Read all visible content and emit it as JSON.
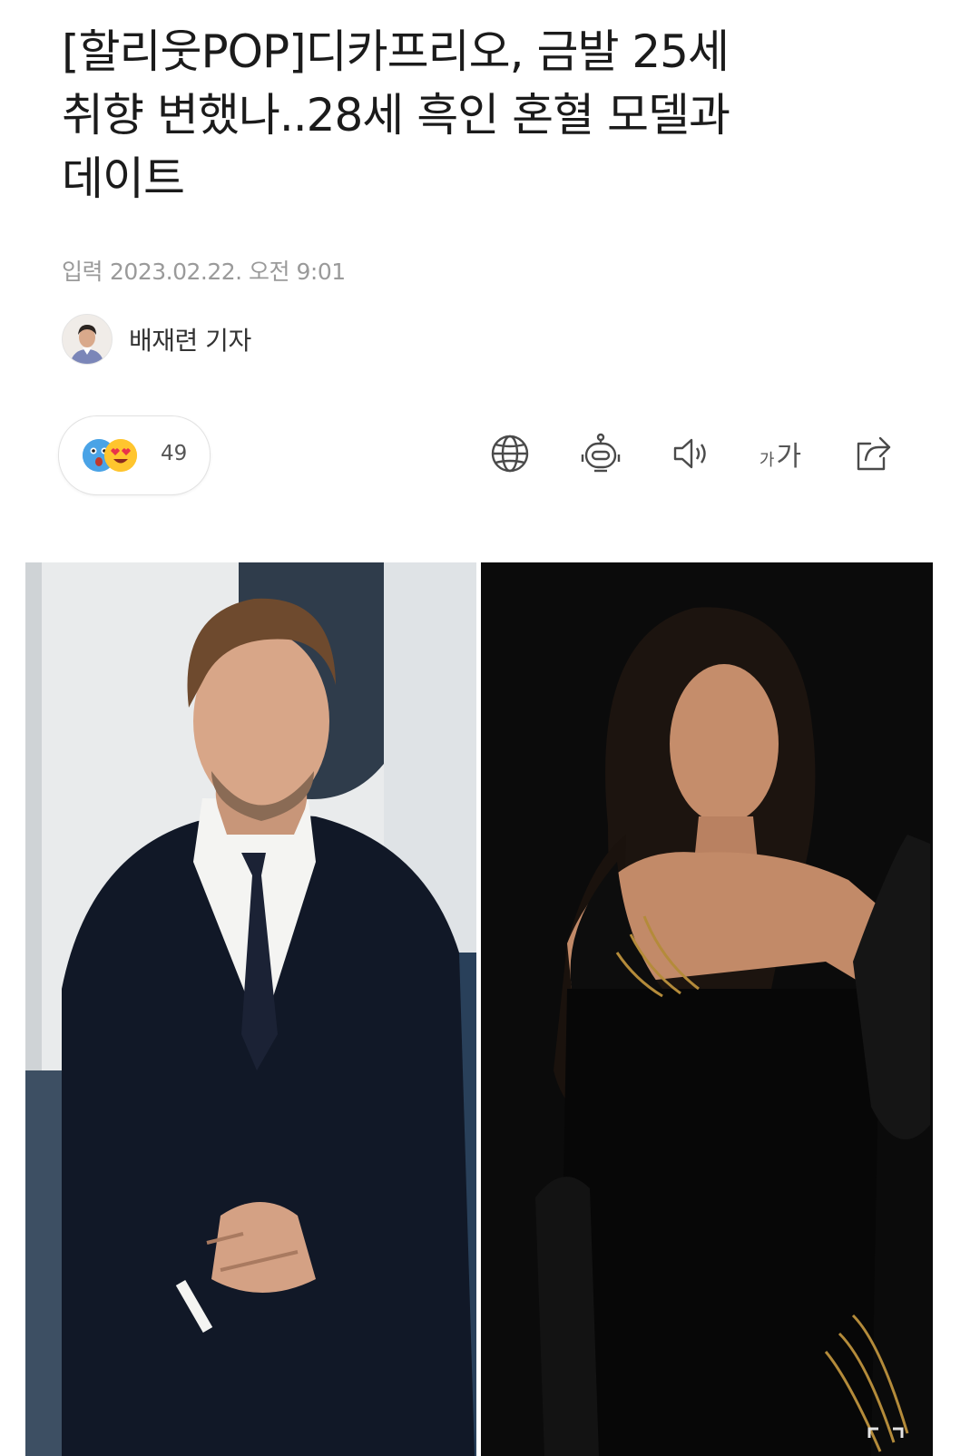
{
  "article": {
    "headline_line1": "[할리웃POP]디카프리오, 금발 25세",
    "headline_line2": "취향 변했나..28세 흑인 혼혈 모델과",
    "headline_line3": "데이트",
    "published_label": "입력",
    "published_value": "2023.02.22. 오전 9:01",
    "reporter": "배재련 기자"
  },
  "reactions": {
    "count": "49",
    "icons": [
      "surprised-face-icon",
      "heart-eyes-face-icon"
    ]
  },
  "toolbar": {
    "icons": [
      "globe-icon",
      "robot-icon",
      "speaker-icon",
      "font-size-icon",
      "share-icon"
    ],
    "font_small": "가",
    "font_large": "가"
  },
  "colors": {
    "surprised_face": "#4aa3e6",
    "love_face": "#ffc52e",
    "heart": "#e8334a",
    "icon_stroke": "#4a4a4a"
  }
}
